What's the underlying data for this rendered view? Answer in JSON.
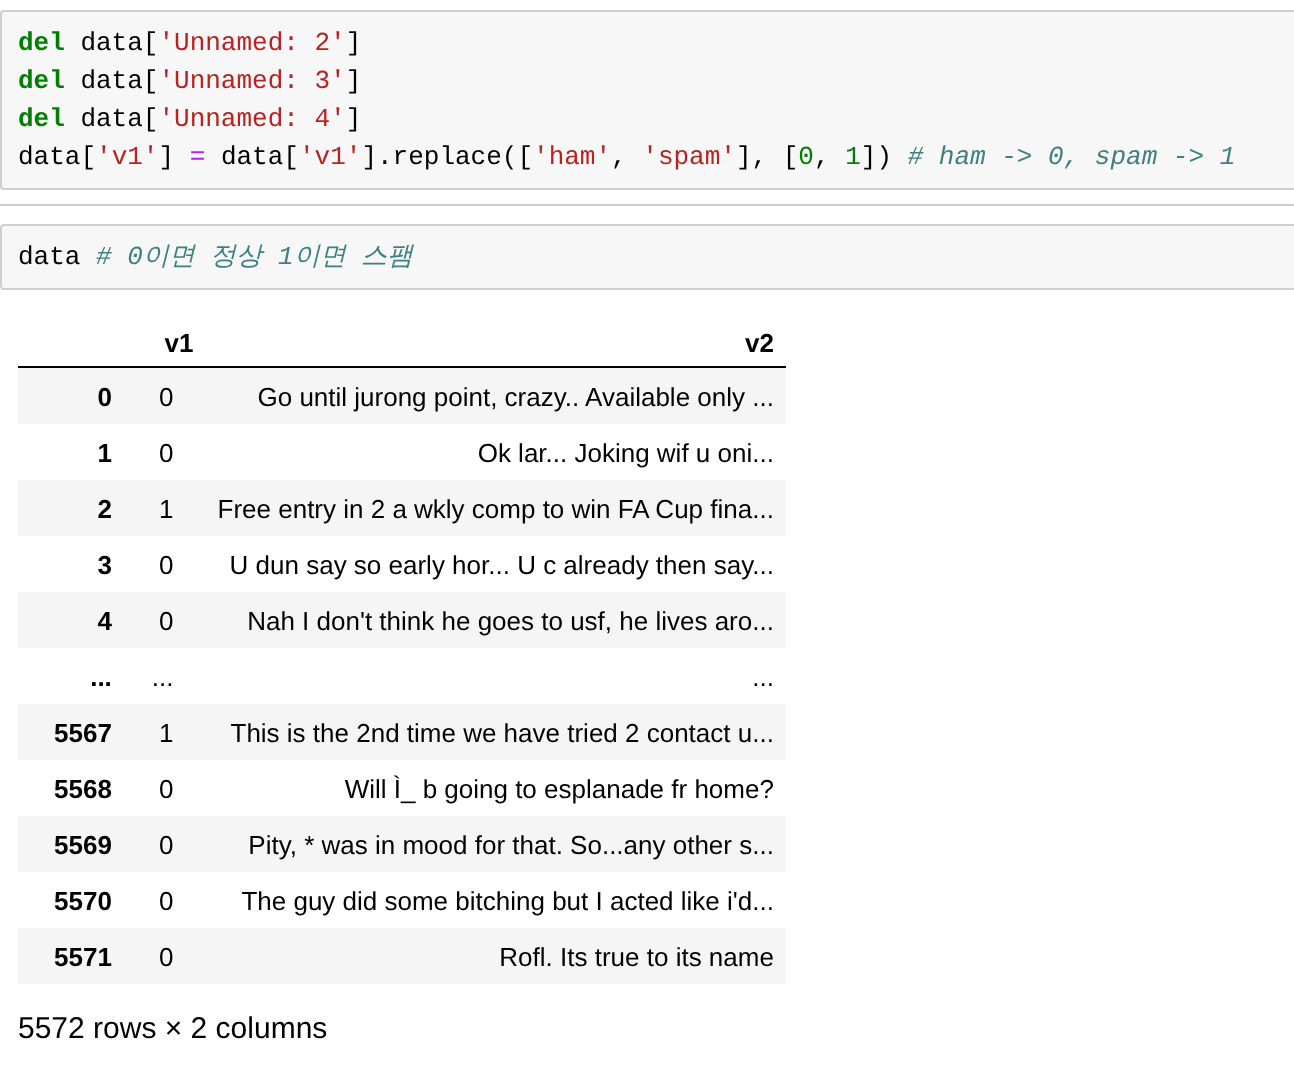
{
  "code_cells": [
    {
      "lines": [
        [
          {
            "kind": "keyword",
            "text": "del"
          },
          {
            "kind": "plain",
            "text": " data["
          },
          {
            "kind": "string",
            "text": "'Unnamed: 2'"
          },
          {
            "kind": "plain",
            "text": "]"
          }
        ],
        [
          {
            "kind": "keyword",
            "text": "del"
          },
          {
            "kind": "plain",
            "text": " data["
          },
          {
            "kind": "string",
            "text": "'Unnamed: 3'"
          },
          {
            "kind": "plain",
            "text": "]"
          }
        ],
        [
          {
            "kind": "keyword",
            "text": "del"
          },
          {
            "kind": "plain",
            "text": " data["
          },
          {
            "kind": "string",
            "text": "'Unnamed: 4'"
          },
          {
            "kind": "plain",
            "text": "]"
          }
        ],
        [
          {
            "kind": "plain",
            "text": "data["
          },
          {
            "kind": "string",
            "text": "'v1'"
          },
          {
            "kind": "plain",
            "text": "] "
          },
          {
            "kind": "operator",
            "text": "="
          },
          {
            "kind": "plain",
            "text": " data["
          },
          {
            "kind": "string",
            "text": "'v1'"
          },
          {
            "kind": "plain",
            "text": "].replace(["
          },
          {
            "kind": "string",
            "text": "'ham'"
          },
          {
            "kind": "plain",
            "text": ", "
          },
          {
            "kind": "string",
            "text": "'spam'"
          },
          {
            "kind": "plain",
            "text": "], ["
          },
          {
            "kind": "number",
            "text": "0"
          },
          {
            "kind": "plain",
            "text": ", "
          },
          {
            "kind": "number",
            "text": "1"
          },
          {
            "kind": "plain",
            "text": "]) "
          },
          {
            "kind": "comment",
            "text": "# ham -> 0, spam -> 1"
          }
        ]
      ]
    },
    {
      "lines": [
        [
          {
            "kind": "plain",
            "text": "data "
          },
          {
            "kind": "comment",
            "text": "# 0이면 정상 1이면 스팸"
          }
        ]
      ]
    }
  ],
  "table": {
    "columns": [
      "v1",
      "v2"
    ],
    "rows": [
      {
        "index": "0",
        "v1": "0",
        "v2": "Go until jurong point, crazy.. Available only ..."
      },
      {
        "index": "1",
        "v1": "0",
        "v2": "Ok lar... Joking wif u oni..."
      },
      {
        "index": "2",
        "v1": "1",
        "v2": "Free entry in 2 a wkly comp to win FA Cup fina..."
      },
      {
        "index": "3",
        "v1": "0",
        "v2": "U dun say so early hor... U c already then say..."
      },
      {
        "index": "4",
        "v1": "0",
        "v2": "Nah I don't think he goes to usf, he lives aro..."
      },
      {
        "index": "...",
        "v1": "...",
        "v2": "..."
      },
      {
        "index": "5567",
        "v1": "1",
        "v2": "This is the 2nd time we have tried 2 contact u..."
      },
      {
        "index": "5568",
        "v1": "0",
        "v2": "Will Ì_ b going to esplanade fr home?"
      },
      {
        "index": "5569",
        "v1": "0",
        "v2": "Pity, * was in mood for that. So...any other s..."
      },
      {
        "index": "5570",
        "v1": "0",
        "v2": "The guy did some bitching but I acted like i'd..."
      },
      {
        "index": "5571",
        "v1": "0",
        "v2": "Rofl. Its true to its name"
      }
    ]
  },
  "shape": "5572 rows × 2 columns"
}
